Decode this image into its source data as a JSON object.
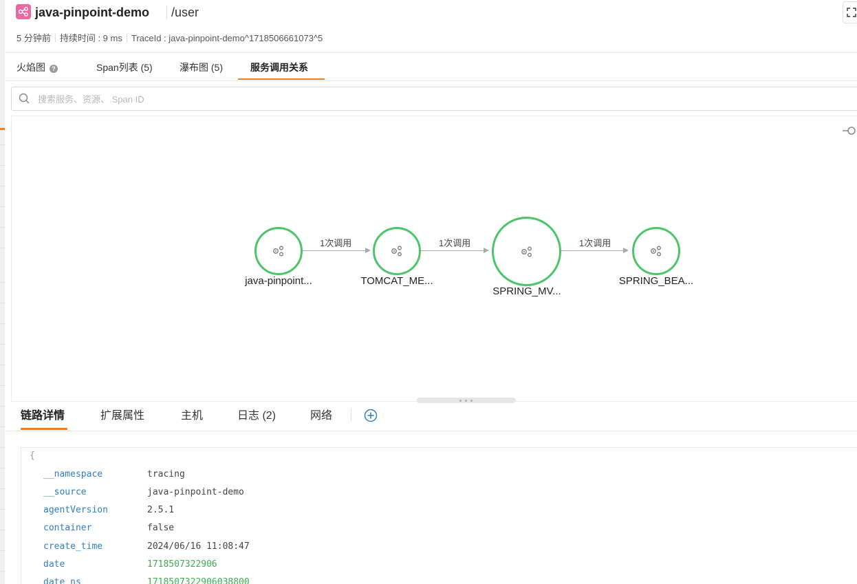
{
  "header": {
    "app_name": "java-pinpoint-demo",
    "route": "/user",
    "time_ago": "5 分钟前",
    "duration": "持续时间 : 9 ms",
    "trace_id": "TraceId : java-pinpoint-demo^1718506661073^5"
  },
  "tabs": [
    {
      "label": "火焰图"
    },
    {
      "label": "Span列表 (5)"
    },
    {
      "label": "瀑布图 (5)"
    },
    {
      "label": "服务调用关系"
    }
  ],
  "search": {
    "placeholder": "搜索服务、资源、 Span ID"
  },
  "graph": {
    "nodes": [
      {
        "label": "java-pinpoint..."
      },
      {
        "label": "TOMCAT_ME..."
      },
      {
        "label": "SPRING_MV..."
      },
      {
        "label": "SPRING_BEA..."
      }
    ],
    "edges": [
      {
        "label": "1次调用"
      },
      {
        "label": "1次调用"
      },
      {
        "label": "1次调用"
      }
    ],
    "node_color": "#4cc46a"
  },
  "bottom_tabs": [
    {
      "label": "链路详情"
    },
    {
      "label": "扩展属性"
    },
    {
      "label": "主机"
    },
    {
      "label": "日志 (2)"
    },
    {
      "label": "网络"
    }
  ],
  "details": {
    "open_brace": "{",
    "rows": [
      {
        "key": "__namespace",
        "value": "tracing"
      },
      {
        "key": "__source",
        "value": "java-pinpoint-demo"
      },
      {
        "key": "agentVersion",
        "value": "2.5.1"
      },
      {
        "key": "container",
        "value": "false"
      },
      {
        "key": "create_time",
        "value": "2024/06/16 11:08:47"
      },
      {
        "key": "date",
        "value": "1718507322906"
      },
      {
        "key": "date_ns",
        "value": "1718507322906038800"
      }
    ]
  },
  "colors": {
    "accent": "#f07d26",
    "key": "#2f7ec1",
    "number": "#3ab054"
  }
}
